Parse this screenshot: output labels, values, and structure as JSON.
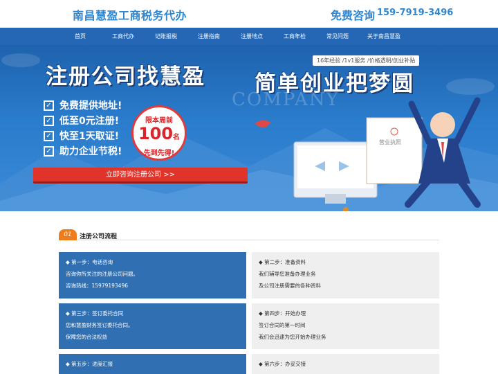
{
  "header": {
    "logo": "南昌慧盈工商税务代办",
    "hotline_label": "免费咨询",
    "phone": "159-7919-3496"
  },
  "nav": {
    "items": [
      "首页",
      "工商代办",
      "记账报税",
      "注册指南",
      "注册地点",
      "工商年检",
      "常见问题",
      "关于南昌慧盈"
    ]
  },
  "banner": {
    "title_left": "注册公司找慧盈",
    "title_right": "简单创业把梦圆",
    "tag": "16年经验 /1v1服务 /价格透明/创业补贴",
    "watermark": "COMPANY",
    "features": [
      "免费提供地址!",
      "低至0元注册!",
      "快至1天取证!",
      "助力企业节税!"
    ],
    "badge": {
      "line1": "限本周前",
      "number": "100",
      "unit": "名",
      "line3": "先到先得!"
    },
    "license_text": "营业执照",
    "cta": "立即咨询注册公司 >>"
  },
  "section": {
    "num": "01",
    "title": "注册公司流程"
  },
  "steps": [
    {
      "title": "◆ 第一步：电话咨询",
      "lines": [
        "咨询你所关注的注册公司问题。",
        "咨询热线：15979193496"
      ]
    },
    {
      "title": "◆ 第二步：准备资料",
      "lines": [
        "我们辅导您准备办理业务",
        "及公司注册需要的各种资料"
      ]
    },
    {
      "title": "◆ 第三步：签订委托合同",
      "lines": [
        "您和慧盈财务签订委托合同。",
        "保障您的合法权益"
      ]
    },
    {
      "title": "◆ 第四步：开始办理",
      "lines": [
        "签订合同的第一时间",
        "我们会迅速为您开始办理业务"
      ]
    },
    {
      "title": "◆ 第五步：进度汇报",
      "lines": []
    },
    {
      "title": "◆ 第六步：办妥交接",
      "lines": []
    }
  ],
  "colors": {
    "brand_blue": "#2567b4",
    "accent_red": "#e0332a",
    "accent_orange": "#ef7c1a"
  }
}
